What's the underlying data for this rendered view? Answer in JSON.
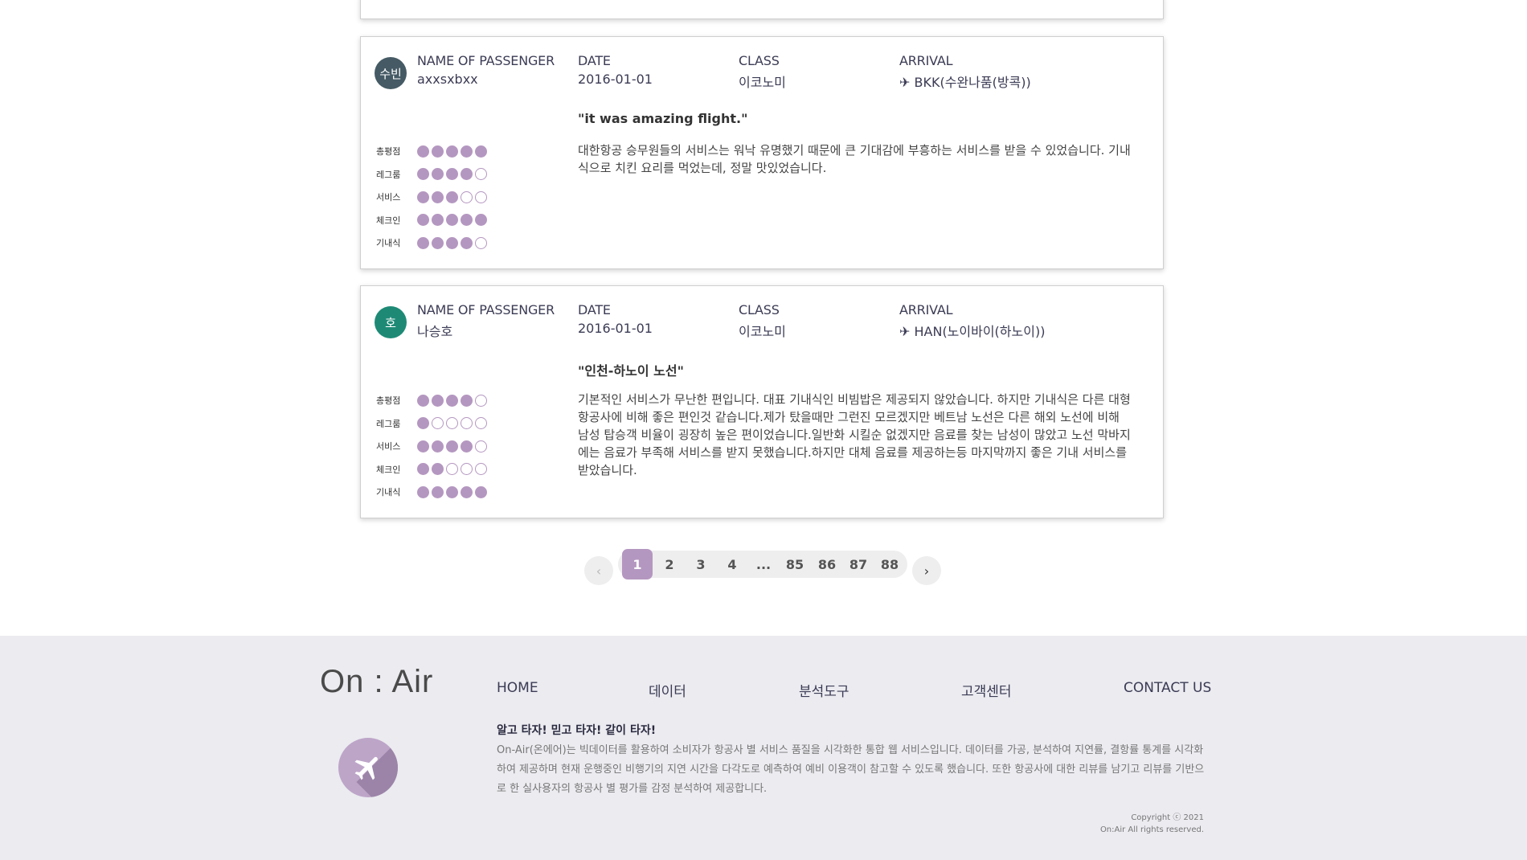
{
  "reviews": [
    {
      "avatar_text": "수빈",
      "avatar_color": "#455a64",
      "name_label": "NAME OF PASSENGER",
      "name": "axxsxbxx",
      "date_label": "DATE",
      "date": "2016-01-01",
      "class_label": "CLASS",
      "class": "이코노미",
      "arrival_label": "ARRIVAL",
      "arrival": "✈ BKK(수완나품(방콕))",
      "title": "\"it was amazing flight.\"",
      "body": "대한항공 승무원들의 서비스는 워낙 유명했기 때문에 큰 기대감에 부흥하는 서비스를 받을 수 있었습니다. 기내식으로 치킨 요리를 먹었는데, 정말 맛있었습니다.",
      "ratings": [
        {
          "label": "총평점",
          "score": 5
        },
        {
          "label": "레그룸",
          "score": 4
        },
        {
          "label": "서비스",
          "score": 3
        },
        {
          "label": "체크인",
          "score": 5
        },
        {
          "label": "기내식",
          "score": 4
        }
      ]
    },
    {
      "avatar_text": "호",
      "avatar_color": "#1e8a76",
      "name_label": "NAME OF PASSENGER",
      "name": "나승호",
      "date_label": "DATE",
      "date": "2016-01-01",
      "class_label": "CLASS",
      "class": "이코노미",
      "arrival_label": "ARRIVAL",
      "arrival": "✈ HAN(노이바이(하노이))",
      "title": "\"인천-하노이 노선\"",
      "body": "기본적인 서비스가 무난한 편입니다. 대표 기내식인 비빔밥은 제공되지 않았습니다. 하지만 기내식은 다른 대형항공사에 비해 좋은 편인것 같습니다.제가 탔을때만 그런진 모르겠지만 베트남 노선은 다른 해외 노선에 비해 남성 탑승객 비율이 굉장히 높은 편이었습니다.일반화 시킬순 없겠지만 음료를 찾는 남성이 많았고 노선 막바지에는 음료가 부족해 서비스를 받지 못했습니다.하지만 대체 음료를 제공하는등 마지막까지 좋은 기내 서비스를 받았습니다.",
      "ratings": [
        {
          "label": "총평점",
          "score": 4
        },
        {
          "label": "레그룸",
          "score": 1
        },
        {
          "label": "서비스",
          "score": 4
        },
        {
          "label": "체크인",
          "score": 2
        },
        {
          "label": "기내식",
          "score": 5
        }
      ]
    }
  ],
  "pagination": {
    "prev": "‹",
    "next": "›",
    "pages": [
      "1",
      "2",
      "3",
      "4",
      "...",
      "85",
      "86",
      "87",
      "88"
    ],
    "current": "1"
  },
  "footer": {
    "logo": "On : Air",
    "nav": [
      "HOME",
      "데이터",
      "분석도구",
      "고객센터",
      "CONTACT US"
    ],
    "slogan": "알고 타자! 믿고 타자! 같이 타자!",
    "description": "On-Air(온에어)는 빅데이터를 활용하여 소비자가 항공사 별 서비스 품질을 시각화한 통합 웹 서비스입니다. 데이터를 가공, 분석하여 지연률, 결항률 통계를 시각화하여 제공하며 현재 운행중인 비행기의 지연 시간을 다각도로 예측하여 예비 이용객이 참고할 수 있도록 했습니다. 또한 항공사에 대한 리뷰를 남기고 리뷰를 기반으로 한 실사용자의 항공사 별 평가를 감정 분석하여 제공합니다.",
    "copyright_line1": "Copyright ⓒ 2021",
    "copyright_line2": "On:Air All rights reserved."
  },
  "colors": {
    "accent": "#b497c0",
    "footer_bg": "#ebebf0"
  }
}
